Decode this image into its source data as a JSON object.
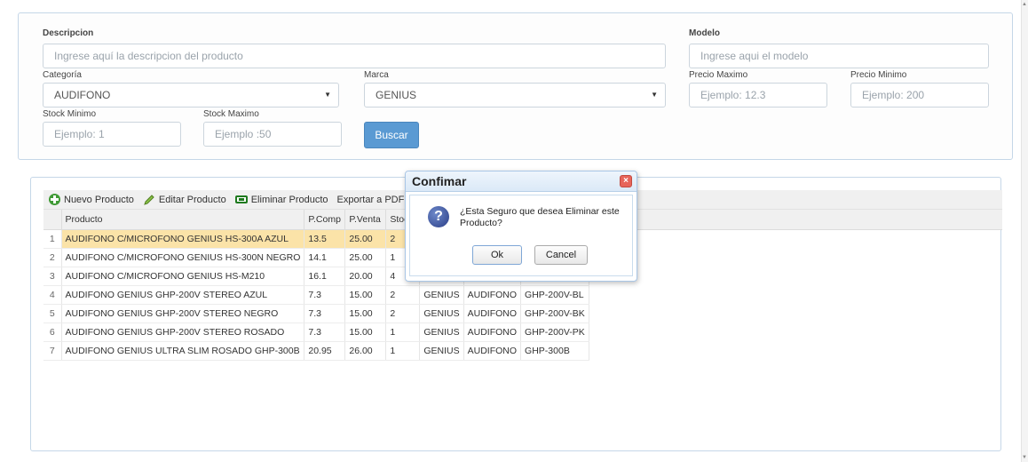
{
  "search": {
    "descripcion_label": "Descripcion",
    "descripcion_placeholder": "Ingrese aquí la descripcion del producto",
    "modelo_label": "Modelo",
    "modelo_placeholder": "Ingrese aqui el modelo",
    "categoria_label": "Categoría",
    "categoria_value": "AUDIFONO",
    "marca_label": "Marca",
    "marca_value": "GENIUS",
    "precio_max_label": "Precio Maximo",
    "precio_max_placeholder": "Ejemplo: 12.3",
    "precio_min_label": "Precio Minimo",
    "precio_min_placeholder": "Ejemplo: 200",
    "stock_min_label": "Stock Minimo",
    "stock_min_placeholder": "Ejemplo: 1",
    "stock_max_label": "Stock Maximo",
    "stock_max_placeholder": "Ejemplo :50",
    "buscar_label": "Buscar"
  },
  "toolbar": {
    "nuevo": "Nuevo Producto",
    "editar": "Editar Producto",
    "eliminar": "Eliminar Producto",
    "exportar": "Exportar a PDF"
  },
  "grid": {
    "columns": [
      "Producto",
      "P.Comp",
      "P.Venta",
      "Stoc",
      "",
      "",
      ""
    ],
    "rows": [
      {
        "n": "1",
        "producto": "AUDIFONO C/MICROFONO GENIUS HS-300A AZUL",
        "pcomp": "13.5",
        "pventa": "25.00",
        "stock": "2",
        "marca": "",
        "categoria": "",
        "modelo": ""
      },
      {
        "n": "2",
        "producto": "AUDIFONO C/MICROFONO GENIUS HS-300N NEGRO",
        "pcomp": "14.1",
        "pventa": "25.00",
        "stock": "1",
        "marca": "",
        "categoria": "",
        "modelo": ""
      },
      {
        "n": "3",
        "producto": "AUDIFONO C/MICROFONO GENIUS HS-M210",
        "pcomp": "16.1",
        "pventa": "20.00",
        "stock": "4",
        "marca": "",
        "categoria": "",
        "modelo": ""
      },
      {
        "n": "4",
        "producto": "AUDIFONO GENIUS GHP-200V STEREO AZUL",
        "pcomp": "7.3",
        "pventa": "15.00",
        "stock": "2",
        "marca": "GENIUS",
        "categoria": "AUDIFONO",
        "modelo": "GHP-200V-BL"
      },
      {
        "n": "5",
        "producto": "AUDIFONO GENIUS GHP-200V STEREO NEGRO",
        "pcomp": "7.3",
        "pventa": "15.00",
        "stock": "2",
        "marca": "GENIUS",
        "categoria": "AUDIFONO",
        "modelo": "GHP-200V-BK"
      },
      {
        "n": "6",
        "producto": "AUDIFONO GENIUS GHP-200V STEREO ROSADO",
        "pcomp": "7.3",
        "pventa": "15.00",
        "stock": "1",
        "marca": "GENIUS",
        "categoria": "AUDIFONO",
        "modelo": "GHP-200V-PK"
      },
      {
        "n": "7",
        "producto": "AUDIFONO GENIUS ULTRA SLIM ROSADO GHP-300B",
        "pcomp": "20.95",
        "pventa": "26.00",
        "stock": "1",
        "marca": "GENIUS",
        "categoria": "AUDIFONO",
        "modelo": "GHP-300B"
      }
    ]
  },
  "dialog": {
    "title": "Confimar",
    "message": "¿Esta Seguro que desea Eliminar este Producto?",
    "ok": "Ok",
    "cancel": "Cancel",
    "close_glyph": "×"
  },
  "colors": {
    "accent": "#5a9ad3",
    "selected_row": "#fbe3a8",
    "panel_border": "#c5d7e8"
  }
}
